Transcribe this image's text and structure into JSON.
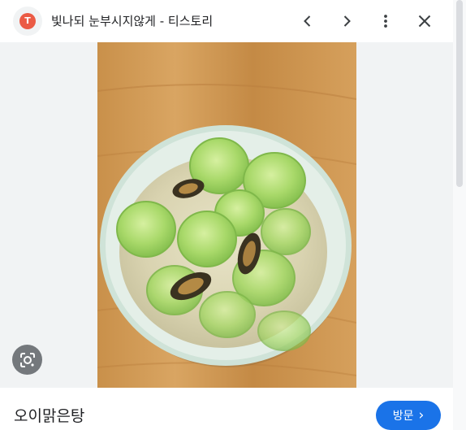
{
  "header": {
    "favicon_letter": "T",
    "title": "빛나되 눈부시지않게 - 티스토리",
    "back_icon": "chevron-left-icon",
    "forward_icon": "chevron-right-icon",
    "more_icon": "more-vert-icon",
    "close_icon": "close-icon"
  },
  "image": {
    "lens_icon": "lens-search-icon"
  },
  "footer": {
    "caption": "오이맑은탕",
    "visit_label": "방문",
    "visit_arrow": "›"
  },
  "colors": {
    "accent": "#1a73e8",
    "favicon": "#eb5b45",
    "panel_bg": "#f1f3f4"
  }
}
